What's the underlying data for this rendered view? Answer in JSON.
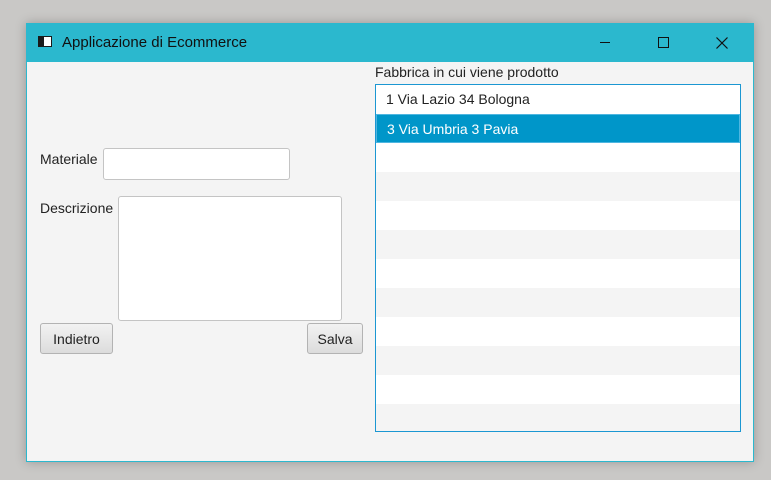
{
  "window": {
    "title": "Applicazione di Ecommerce",
    "controls": [
      "minimize-icon",
      "maximize-icon",
      "close-icon"
    ],
    "titlebar_color": "#2bb8ce"
  },
  "form": {
    "materiale_label": "Materiale",
    "materiale_value": "",
    "descrizione_label": "Descrizione",
    "descrizione_value": "",
    "back_button": "Indietro",
    "save_button": "Salva"
  },
  "factory_list": {
    "label": "Fabbrica in cui viene prodotto",
    "items": [
      {
        "text": "1 Via Lazio 34 Bologna",
        "selected": false
      },
      {
        "text": "3 Via Umbria 3 Pavia",
        "selected": true
      }
    ],
    "selection_color": "#0096c9"
  }
}
